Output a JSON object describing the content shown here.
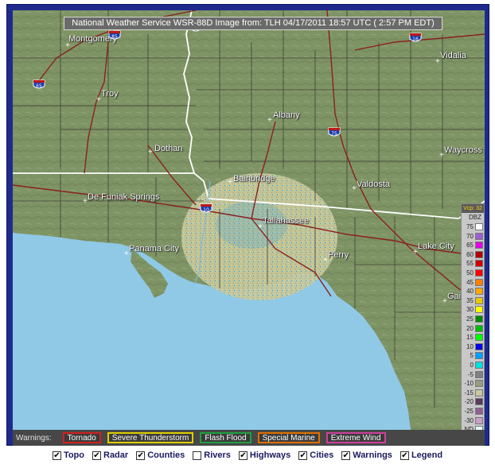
{
  "header": {
    "title": "National Weather Service WSR-88D Image from: TLH 04/17/2011 18:57 UTC ( 2:57 PM EDT)"
  },
  "map": {
    "colors": {
      "land": "#7f9465",
      "water": "#8fc9e6",
      "roads": "#8a2020",
      "county": "#2b2b2b",
      "state": "#ffffff"
    },
    "cities": [
      {
        "name": "Montgomery"
      },
      {
        "name": "Troy"
      },
      {
        "name": "Dothan"
      },
      {
        "name": "Albany"
      },
      {
        "name": "Vidalia"
      },
      {
        "name": "Waycross"
      },
      {
        "name": "Bainbridge"
      },
      {
        "name": "Valdosta"
      },
      {
        "name": "De Funiak Springs"
      },
      {
        "name": "Tallahassee"
      },
      {
        "name": "Panama City"
      },
      {
        "name": "Perry"
      },
      {
        "name": "Lake City"
      },
      {
        "name": "Gai"
      }
    ],
    "shields": [
      {
        "id": "i85",
        "label": "85"
      },
      {
        "id": "i185",
        "label": "185"
      },
      {
        "id": "i16",
        "label": "16"
      },
      {
        "id": "i65",
        "label": "65"
      },
      {
        "id": "i75",
        "label": "75"
      },
      {
        "id": "i10",
        "label": "10"
      }
    ]
  },
  "legend": {
    "vcp": "Vcp: 32",
    "unit": "DBZ",
    "rows": [
      {
        "value": "75",
        "color": "#ffffff"
      },
      {
        "value": "70",
        "color": "#9a5fd0"
      },
      {
        "value": "65",
        "color": "#e000e0"
      },
      {
        "value": "60",
        "color": "#b00000"
      },
      {
        "value": "55",
        "color": "#d00000"
      },
      {
        "value": "50",
        "color": "#ff0000"
      },
      {
        "value": "45",
        "color": "#ff7f00"
      },
      {
        "value": "40",
        "color": "#ffa800"
      },
      {
        "value": "35",
        "color": "#e8c800"
      },
      {
        "value": "30",
        "color": "#ffff00"
      },
      {
        "value": "25",
        "color": "#008800"
      },
      {
        "value": "20",
        "color": "#00bb00"
      },
      {
        "value": "15",
        "color": "#00ff00"
      },
      {
        "value": "10",
        "color": "#0000dd"
      },
      {
        "value": "5",
        "color": "#00a0ff"
      },
      {
        "value": "0",
        "color": "#00e0e0"
      },
      {
        "value": "-5",
        "color": "#7f7f7f"
      },
      {
        "value": "-10",
        "color": "#9a9a80"
      },
      {
        "value": "-15",
        "color": "#c8c8a0"
      },
      {
        "value": "-20",
        "color": "#5a3a5a"
      },
      {
        "value": "-25",
        "color": "#906090"
      },
      {
        "value": "-30",
        "color": "#c8a0c8"
      },
      {
        "value": "ND",
        "color": "#e0ffff"
      }
    ]
  },
  "warnings": {
    "label": "Warnings:",
    "items": [
      {
        "label": "Tornado",
        "color": "#d02020"
      },
      {
        "label": "Severe Thunderstorm",
        "color": "#e0d000"
      },
      {
        "label": "Flash Flood",
        "color": "#20a040"
      },
      {
        "label": "Special Marine",
        "color": "#e07000"
      },
      {
        "label": "Extreme Wind",
        "color": "#d040a0"
      }
    ]
  },
  "layers": [
    {
      "label": "Topo",
      "checked": true
    },
    {
      "label": "Radar",
      "checked": true
    },
    {
      "label": "Counties",
      "checked": true
    },
    {
      "label": "Rivers",
      "checked": false
    },
    {
      "label": "Highways",
      "checked": true
    },
    {
      "label": "Cities",
      "checked": true
    },
    {
      "label": "Warnings",
      "checked": true
    },
    {
      "label": "Legend",
      "checked": true
    }
  ]
}
